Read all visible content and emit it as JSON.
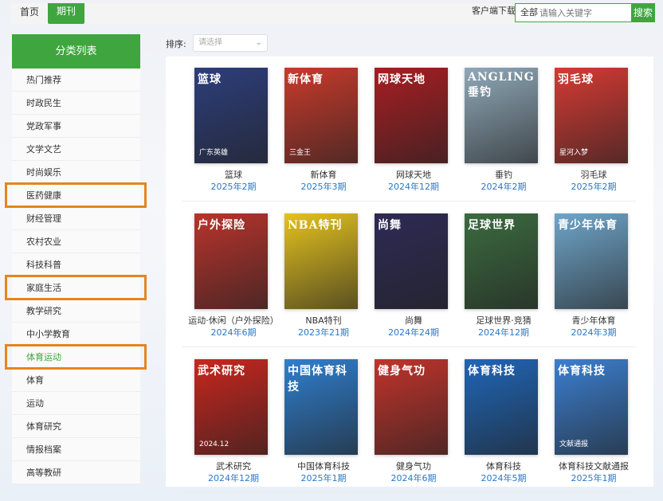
{
  "nav": {
    "home": "首页",
    "journal": "期刊"
  },
  "top": {
    "client_download": "客户端下载",
    "search_scope": "全部",
    "search_placeholder": "请输入关键字",
    "search_button": "搜索"
  },
  "sidebar": {
    "header": "分类列表",
    "items": [
      {
        "label": "热门推荐"
      },
      {
        "label": "时政民生"
      },
      {
        "label": "党政军事"
      },
      {
        "label": "文学文艺"
      },
      {
        "label": "时尚娱乐"
      },
      {
        "label": "医药健康"
      },
      {
        "label": "财经管理"
      },
      {
        "label": "农村农业"
      },
      {
        "label": "科技科普"
      },
      {
        "label": "家庭生活"
      },
      {
        "label": "教学研究"
      },
      {
        "label": "中小学教育"
      },
      {
        "label": "体育运动"
      },
      {
        "label": "体育"
      },
      {
        "label": "运动"
      },
      {
        "label": "体育研究"
      },
      {
        "label": "情报档案"
      },
      {
        "label": "高等教研"
      }
    ],
    "active_index": 12,
    "highlighted": [
      "医药健康",
      "家庭生活",
      "体育运动"
    ]
  },
  "sort": {
    "label": "排序:",
    "placeholder": "请选择"
  },
  "magazines": [
    {
      "name": "篮球",
      "issue": "2025年2期",
      "cover_title": "篮球",
      "cover_sub": "广东英雄",
      "color": "#2d3e7c"
    },
    {
      "name": "新体育",
      "issue": "2025年3期",
      "cover_title": "新体育",
      "cover_sub": "三金王",
      "color": "#c93a2b"
    },
    {
      "name": "网球天地",
      "issue": "2024年12期",
      "cover_title": "网球天地",
      "cover_sub": "",
      "color": "#a81e22"
    },
    {
      "name": "垂钓",
      "issue": "2024年2期",
      "cover_title": "ANGLING 垂钓",
      "cover_sub": "",
      "color": "#8fa8b8"
    },
    {
      "name": "羽毛球",
      "issue": "2025年2期",
      "cover_title": "羽毛球",
      "cover_sub": "星河入梦",
      "color": "#d73a33"
    },
    {
      "name": "运动·休闲（户外探险）",
      "issue": "2024年6期",
      "cover_title": "户外探险",
      "cover_sub": "",
      "color": "#b9332c"
    },
    {
      "name": "NBA特刊",
      "issue": "2023年21期",
      "cover_title": "NBA特刊",
      "cover_sub": "",
      "color": "#e4c21e"
    },
    {
      "name": "尚舞",
      "issue": "2024年24期",
      "cover_title": "尚舞",
      "cover_sub": "",
      "color": "#2e2a55"
    },
    {
      "name": "足球世界·竞猜",
      "issue": "2024年12期",
      "cover_title": "足球世界",
      "cover_sub": "",
      "color": "#3b6b3f"
    },
    {
      "name": "青少年体育",
      "issue": "2024年3期",
      "cover_title": "青少年体育",
      "cover_sub": "",
      "color": "#6fa5c9"
    },
    {
      "name": "武术研究",
      "issue": "2024年12期",
      "cover_title": "武术研究",
      "cover_sub": "2024.12",
      "color": "#c9261e"
    },
    {
      "name": "中国体育科技",
      "issue": "2025年1期",
      "cover_title": "中国体育科技",
      "cover_sub": "",
      "color": "#2f7fcf"
    },
    {
      "name": "健身气功",
      "issue": "2024年6期",
      "cover_title": "健身气功",
      "cover_sub": "",
      "color": "#c2332b"
    },
    {
      "name": "体育科技",
      "issue": "2024年5期",
      "cover_title": "体育科技",
      "cover_sub": "",
      "color": "#1f66b8"
    },
    {
      "name": "体育科技文献通报",
      "issue": "2025年1期",
      "cover_title": "体育科技",
      "cover_sub": "文献通报",
      "color": "#3b7fd0"
    }
  ],
  "colors": {
    "accent": "#3fa63f",
    "highlight_box": "#e3861f",
    "issue_link": "#2a78c6"
  }
}
